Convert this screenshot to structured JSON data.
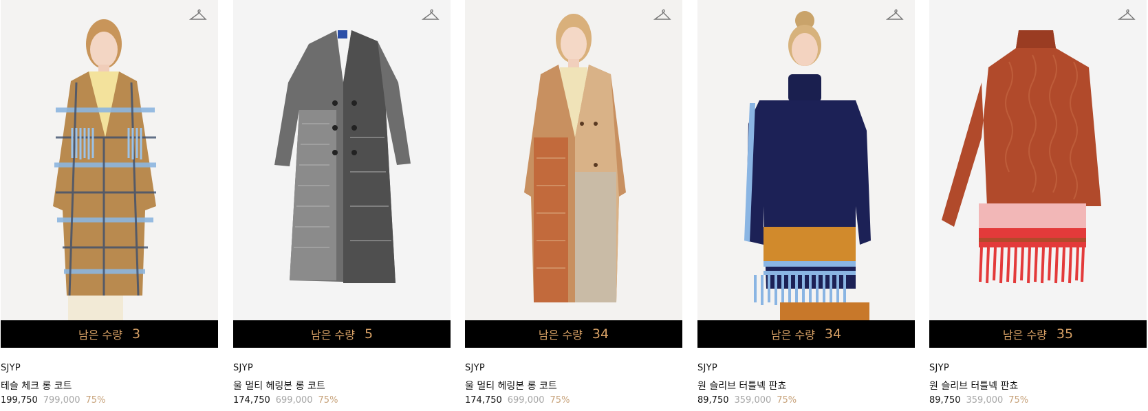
{
  "products": [
    {
      "stock_label": "남은 수량",
      "stock_count": "3",
      "brand": "SJYP",
      "name": "테슬 체크 롱 코트",
      "sale_price": "199,750",
      "original_price": "799,000",
      "discount": "75%"
    },
    {
      "stock_label": "남은 수량",
      "stock_count": "5",
      "brand": "SJYP",
      "name": "울 멀티 헤링본 롱 코트",
      "sale_price": "174,750",
      "original_price": "699,000",
      "discount": "75%"
    },
    {
      "stock_label": "남은 수량",
      "stock_count": "34",
      "brand": "SJYP",
      "name": "울 멀티 헤링본 롱 코트",
      "sale_price": "174,750",
      "original_price": "699,000",
      "discount": "75%"
    },
    {
      "stock_label": "남은 수량",
      "stock_count": "34",
      "brand": "SJYP",
      "name": "원 슬리브 터틀넥 판쵸",
      "sale_price": "89,750",
      "original_price": "359,000",
      "discount": "75%"
    },
    {
      "stock_label": "남은 수량",
      "stock_count": "35",
      "brand": "SJYP",
      "name": "원 슬리브 터틀넥 판쵸",
      "sale_price": "89,750",
      "original_price": "359,000",
      "discount": "75%"
    }
  ],
  "icons": {
    "wishlist": "hanger-icon"
  },
  "colors": {
    "stock_bar_bg": "#000000",
    "stock_text": "#d9a266",
    "original_price": "#a6a6a6",
    "discount": "#c7a27a"
  }
}
